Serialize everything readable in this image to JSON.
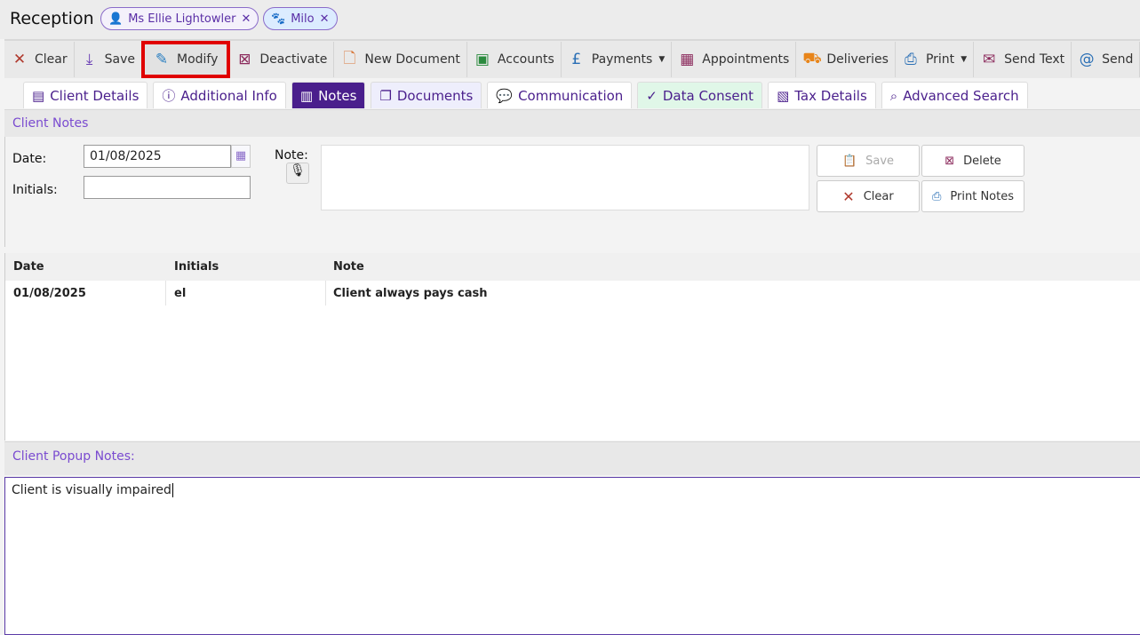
{
  "header": {
    "title": "Reception",
    "chips": [
      {
        "label": "Ms Ellie Lightowler",
        "icon": "person-icon"
      },
      {
        "label": "Milo",
        "icon": "paw-icon"
      }
    ]
  },
  "toolbar": [
    {
      "label": "Clear",
      "icon": "x-icon",
      "color": "#b03a2e"
    },
    {
      "label": "Save",
      "icon": "save-icon",
      "color": "#6a3fb5"
    },
    {
      "label": "Modify",
      "icon": "pencil-icon",
      "color": "#2a7fc1",
      "selected": true
    },
    {
      "label": "Deactivate",
      "icon": "archive-icon",
      "color": "#8b2a5c"
    },
    {
      "label": "New Document",
      "icon": "document-icon",
      "color": "#d9773a"
    },
    {
      "label": "Accounts",
      "icon": "money-icon",
      "color": "#2b8a3e"
    },
    {
      "label": "Payments",
      "icon": "pound-icon",
      "color": "#2a6fb5"
    },
    {
      "label": "Appointments",
      "icon": "calendar-icon",
      "color": "#8b2a5c"
    },
    {
      "label": "Deliveries",
      "icon": "truck-icon",
      "color": "#e8851a"
    },
    {
      "label": "Print",
      "icon": "printer-icon",
      "color": "#2a6fb5"
    },
    {
      "label": "Send Text",
      "icon": "envelope-icon",
      "color": "#8b2a5c"
    },
    {
      "label": "Send",
      "icon": "at-icon",
      "color": "#2a6fb5"
    }
  ],
  "tabs": [
    {
      "label": "Client Details",
      "icon": "id-card-icon"
    },
    {
      "label": "Additional Info",
      "icon": "info-icon"
    },
    {
      "label": "Notes",
      "icon": "clipboard-icon",
      "active": true
    },
    {
      "label": "Documents",
      "icon": "copy-icon"
    },
    {
      "label": "Communication",
      "icon": "chat-icon"
    },
    {
      "label": "Data Consent",
      "icon": "clipboard-check-icon"
    },
    {
      "label": "Tax Details",
      "icon": "receipt-icon"
    },
    {
      "label": "Advanced Search",
      "icon": "search-icon"
    }
  ],
  "notes": {
    "section_title": "Client Notes",
    "date_label": "Date:",
    "date_value": "01/08/2025",
    "initials_label": "Initials:",
    "initials_value": "",
    "note_label": "Note:",
    "note_value": "",
    "buttons": {
      "save": "Save",
      "delete": "Delete",
      "clear": "Clear",
      "print": "Print Notes"
    }
  },
  "grid": {
    "headers": [
      "Date",
      "Initials",
      "Note"
    ],
    "rows": [
      [
        "01/08/2025",
        "el",
        "Client always pays cash"
      ]
    ]
  },
  "popup": {
    "title": "Client Popup Notes:",
    "value": "Client is visually impaired"
  }
}
